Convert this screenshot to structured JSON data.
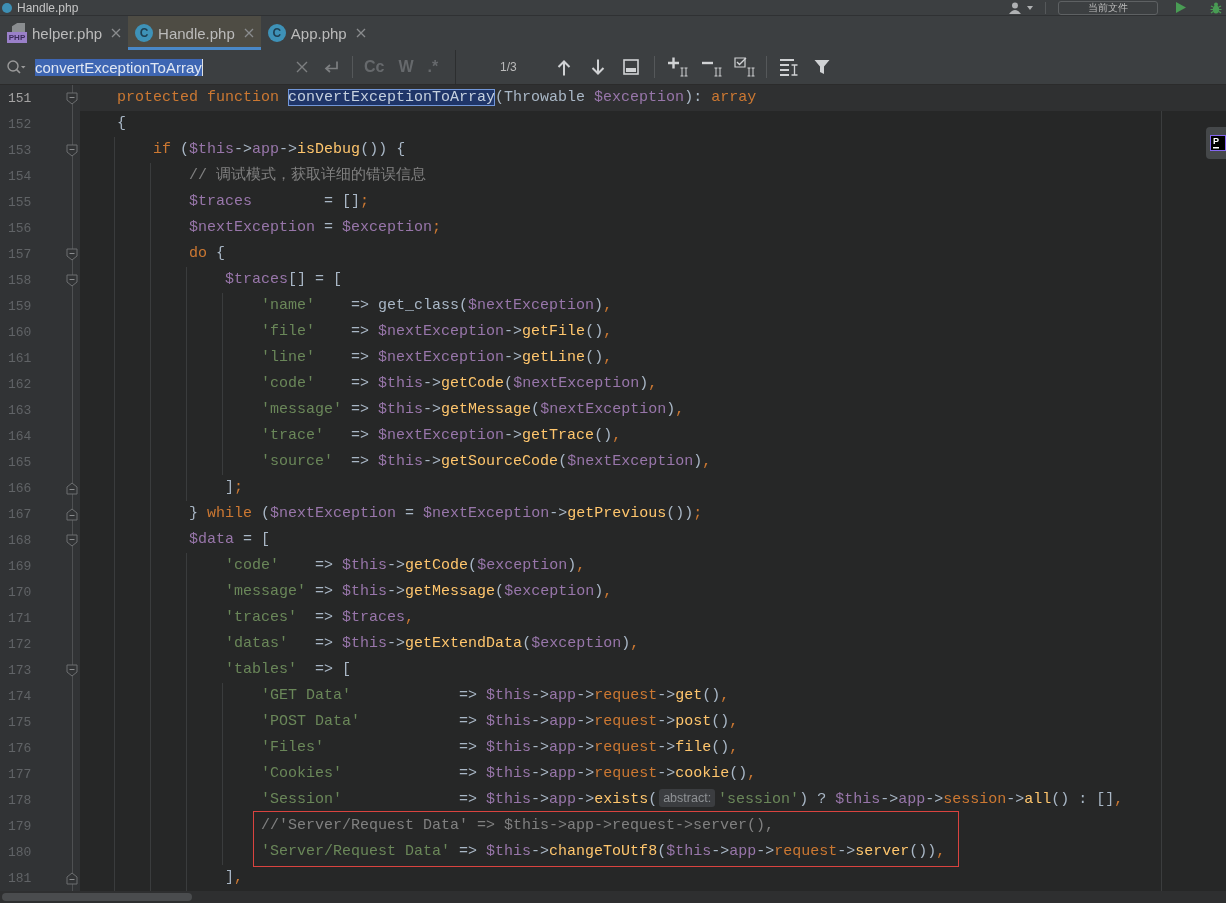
{
  "window": {
    "title": "Handle.php",
    "scope_button": "当前文件"
  },
  "tabs": [
    {
      "label": "helper.php",
      "kind": "php",
      "icon_text": "PHP",
      "selected": false
    },
    {
      "label": "Handle.php",
      "kind": "class",
      "icon_text": "C",
      "selected": true
    },
    {
      "label": "App.php",
      "kind": "class",
      "icon_text": "C",
      "selected": false
    }
  ],
  "search": {
    "query": "convertExceptionToArray",
    "query_selected": true,
    "toggles": [
      {
        "label": "Cc",
        "on": false
      },
      {
        "label": "W",
        "on": false
      },
      {
        "label": ".*",
        "on": false
      }
    ],
    "match_count": "1/3"
  },
  "editor": {
    "blocks": [
      {
        "kind": "plain",
        "lines": [
          {
            "number": "151",
            "kind": "fold_start",
            "current": true,
            "tokens": [
              {
                "kind": "keyword",
                "text": "protected function "
              },
              {
                "kind": "match",
                "text": "convertExceptionToArray"
              },
              {
                "kind": "plain",
                "text": "(Throwable "
              },
              {
                "kind": "variable",
                "text": "$exception"
              },
              {
                "kind": "plain",
                "text": "): "
              },
              {
                "kind": "keyword",
                "text": "array"
              }
            ]
          },
          {
            "number": "152",
            "kind": "plain",
            "current": false,
            "tokens": [
              {
                "kind": "plain",
                "text": "{"
              }
            ]
          },
          {
            "number": "153",
            "kind": "fold_start",
            "current": false,
            "tokens": [
              {
                "kind": "keyword",
                "text": "    if"
              },
              {
                "kind": "plain",
                "text": " ("
              },
              {
                "kind": "variable",
                "text": "$this"
              },
              {
                "kind": "plain",
                "text": "->"
              },
              {
                "kind": "field",
                "text": "app"
              },
              {
                "kind": "plain",
                "text": "->"
              },
              {
                "kind": "method",
                "text": "isDebug"
              },
              {
                "kind": "plain",
                "text": "()) {"
              }
            ]
          },
          {
            "number": "154",
            "kind": "plain",
            "current": false,
            "tokens": [
              {
                "kind": "comment",
                "text": "        // 调试模式，获取详细的错误信息"
              }
            ]
          },
          {
            "number": "155",
            "kind": "plain",
            "current": false,
            "tokens": [
              {
                "kind": "variable",
                "text": "        $traces"
              },
              {
                "kind": "plain",
                "text": "        = []"
              },
              {
                "kind": "punctuation",
                "text": ";"
              }
            ]
          },
          {
            "number": "156",
            "kind": "plain",
            "current": false,
            "tokens": [
              {
                "kind": "variable",
                "text": "        $nextException"
              },
              {
                "kind": "plain",
                "text": " = "
              },
              {
                "kind": "variable",
                "text": "$exception"
              },
              {
                "kind": "punctuation",
                "text": ";"
              }
            ]
          },
          {
            "number": "157",
            "kind": "fold_start",
            "current": false,
            "tokens": [
              {
                "kind": "keyword",
                "text": "        do"
              },
              {
                "kind": "plain",
                "text": " {"
              }
            ]
          },
          {
            "number": "158",
            "kind": "fold_start",
            "current": false,
            "tokens": [
              {
                "kind": "variable",
                "text": "            $traces"
              },
              {
                "kind": "plain",
                "text": "[] = ["
              }
            ]
          },
          {
            "number": "159",
            "kind": "plain",
            "current": false,
            "tokens": [
              {
                "kind": "string",
                "text": "                'name'"
              },
              {
                "kind": "plain",
                "text": "    => get_class("
              },
              {
                "kind": "variable",
                "text": "$nextException"
              },
              {
                "kind": "plain",
                "text": ")"
              },
              {
                "kind": "punctuation",
                "text": ","
              }
            ]
          },
          {
            "number": "160",
            "kind": "plain",
            "current": false,
            "tokens": [
              {
                "kind": "string",
                "text": "                'file'"
              },
              {
                "kind": "plain",
                "text": "    => "
              },
              {
                "kind": "variable",
                "text": "$nextException"
              },
              {
                "kind": "plain",
                "text": "->"
              },
              {
                "kind": "method",
                "text": "getFile"
              },
              {
                "kind": "plain",
                "text": "()"
              },
              {
                "kind": "punctuation",
                "text": ","
              }
            ]
          },
          {
            "number": "161",
            "kind": "plain",
            "current": false,
            "tokens": [
              {
                "kind": "string",
                "text": "                'line'"
              },
              {
                "kind": "plain",
                "text": "    => "
              },
              {
                "kind": "variable",
                "text": "$nextException"
              },
              {
                "kind": "plain",
                "text": "->"
              },
              {
                "kind": "method",
                "text": "getLine"
              },
              {
                "kind": "plain",
                "text": "()"
              },
              {
                "kind": "punctuation",
                "text": ","
              }
            ]
          },
          {
            "number": "162",
            "kind": "plain",
            "current": false,
            "tokens": [
              {
                "kind": "string",
                "text": "                'code'"
              },
              {
                "kind": "plain",
                "text": "    => "
              },
              {
                "kind": "variable",
                "text": "$this"
              },
              {
                "kind": "plain",
                "text": "->"
              },
              {
                "kind": "method",
                "text": "getCode"
              },
              {
                "kind": "plain",
                "text": "("
              },
              {
                "kind": "variable",
                "text": "$nextException"
              },
              {
                "kind": "plain",
                "text": ")"
              },
              {
                "kind": "punctuation",
                "text": ","
              }
            ]
          },
          {
            "number": "163",
            "kind": "plain",
            "current": false,
            "tokens": [
              {
                "kind": "string",
                "text": "                'message'"
              },
              {
                "kind": "plain",
                "text": " => "
              },
              {
                "kind": "variable",
                "text": "$this"
              },
              {
                "kind": "plain",
                "text": "->"
              },
              {
                "kind": "method",
                "text": "getMessage"
              },
              {
                "kind": "plain",
                "text": "("
              },
              {
                "kind": "variable",
                "text": "$nextException"
              },
              {
                "kind": "plain",
                "text": ")"
              },
              {
                "kind": "punctuation",
                "text": ","
              }
            ]
          },
          {
            "number": "164",
            "kind": "plain",
            "current": false,
            "tokens": [
              {
                "kind": "string",
                "text": "                'trace'"
              },
              {
                "kind": "plain",
                "text": "   => "
              },
              {
                "kind": "variable",
                "text": "$nextException"
              },
              {
                "kind": "plain",
                "text": "->"
              },
              {
                "kind": "method",
                "text": "getTrace"
              },
              {
                "kind": "plain",
                "text": "()"
              },
              {
                "kind": "punctuation",
                "text": ","
              }
            ]
          },
          {
            "number": "165",
            "kind": "plain",
            "current": false,
            "tokens": [
              {
                "kind": "string",
                "text": "                'source'"
              },
              {
                "kind": "plain",
                "text": "  => "
              },
              {
                "kind": "variable",
                "text": "$this"
              },
              {
                "kind": "plain",
                "text": "->"
              },
              {
                "kind": "method",
                "text": "getSourceCode"
              },
              {
                "kind": "plain",
                "text": "("
              },
              {
                "kind": "variable",
                "text": "$nextException"
              },
              {
                "kind": "plain",
                "text": ")"
              },
              {
                "kind": "punctuation",
                "text": ","
              }
            ]
          },
          {
            "number": "166",
            "kind": "fold_end",
            "current": false,
            "tokens": [
              {
                "kind": "plain",
                "text": "            ]"
              },
              {
                "kind": "punctuation",
                "text": ";"
              }
            ]
          },
          {
            "number": "167",
            "kind": "fold_end",
            "current": false,
            "tokens": [
              {
                "kind": "plain",
                "text": "        } "
              },
              {
                "kind": "keyword",
                "text": "while"
              },
              {
                "kind": "plain",
                "text": " ("
              },
              {
                "kind": "variable",
                "text": "$nextException"
              },
              {
                "kind": "plain",
                "text": " = "
              },
              {
                "kind": "variable",
                "text": "$nextException"
              },
              {
                "kind": "plain",
                "text": "->"
              },
              {
                "kind": "method",
                "text": "getPrevious"
              },
              {
                "kind": "plain",
                "text": "())"
              },
              {
                "kind": "punctuation",
                "text": ";"
              }
            ]
          },
          {
            "number": "168",
            "kind": "fold_start",
            "current": false,
            "tokens": [
              {
                "kind": "variable",
                "text": "        $data"
              },
              {
                "kind": "plain",
                "text": " = ["
              }
            ]
          },
          {
            "number": "169",
            "kind": "plain",
            "current": false,
            "tokens": [
              {
                "kind": "string",
                "text": "            'code'"
              },
              {
                "kind": "plain",
                "text": "    => "
              },
              {
                "kind": "variable",
                "text": "$this"
              },
              {
                "kind": "plain",
                "text": "->"
              },
              {
                "kind": "method",
                "text": "getCode"
              },
              {
                "kind": "plain",
                "text": "("
              },
              {
                "kind": "variable",
                "text": "$exception"
              },
              {
                "kind": "plain",
                "text": ")"
              },
              {
                "kind": "punctuation",
                "text": ","
              }
            ]
          },
          {
            "number": "170",
            "kind": "plain",
            "current": false,
            "tokens": [
              {
                "kind": "string",
                "text": "            'message'"
              },
              {
                "kind": "plain",
                "text": " => "
              },
              {
                "kind": "variable",
                "text": "$this"
              },
              {
                "kind": "plain",
                "text": "->"
              },
              {
                "kind": "method",
                "text": "getMessage"
              },
              {
                "kind": "plain",
                "text": "("
              },
              {
                "kind": "variable",
                "text": "$exception"
              },
              {
                "kind": "plain",
                "text": ")"
              },
              {
                "kind": "punctuation",
                "text": ","
              }
            ]
          },
          {
            "number": "171",
            "kind": "plain",
            "current": false,
            "tokens": [
              {
                "kind": "string",
                "text": "            'traces'"
              },
              {
                "kind": "plain",
                "text": "  => "
              },
              {
                "kind": "variable",
                "text": "$traces"
              },
              {
                "kind": "punctuation",
                "text": ","
              }
            ]
          },
          {
            "number": "172",
            "kind": "plain",
            "current": false,
            "tokens": [
              {
                "kind": "string",
                "text": "            'datas'"
              },
              {
                "kind": "plain",
                "text": "   => "
              },
              {
                "kind": "variable",
                "text": "$this"
              },
              {
                "kind": "plain",
                "text": "->"
              },
              {
                "kind": "method",
                "text": "getExtendData"
              },
              {
                "kind": "plain",
                "text": "("
              },
              {
                "kind": "variable",
                "text": "$exception"
              },
              {
                "kind": "plain",
                "text": ")"
              },
              {
                "kind": "punctuation",
                "text": ","
              }
            ]
          },
          {
            "number": "173",
            "kind": "fold_start",
            "current": false,
            "tokens": [
              {
                "kind": "string",
                "text": "            'tables'"
              },
              {
                "kind": "plain",
                "text": "  => ["
              }
            ]
          },
          {
            "number": "174",
            "kind": "plain",
            "current": false,
            "tokens": [
              {
                "kind": "string",
                "text": "                'GET Data'"
              },
              {
                "kind": "plain",
                "text": "            => "
              },
              {
                "kind": "variable",
                "text": "$this"
              },
              {
                "kind": "plain",
                "text": "->"
              },
              {
                "kind": "field",
                "text": "app"
              },
              {
                "kind": "plain",
                "text": "->"
              },
              {
                "kind": "magic_field",
                "text": "request"
              },
              {
                "kind": "plain",
                "text": "->"
              },
              {
                "kind": "method",
                "text": "get"
              },
              {
                "kind": "plain",
                "text": "()"
              },
              {
                "kind": "punctuation",
                "text": ","
              }
            ]
          },
          {
            "number": "175",
            "kind": "plain",
            "current": false,
            "tokens": [
              {
                "kind": "string",
                "text": "                'POST Data'"
              },
              {
                "kind": "plain",
                "text": "           => "
              },
              {
                "kind": "variable",
                "text": "$this"
              },
              {
                "kind": "plain",
                "text": "->"
              },
              {
                "kind": "field",
                "text": "app"
              },
              {
                "kind": "plain",
                "text": "->"
              },
              {
                "kind": "magic_field",
                "text": "request"
              },
              {
                "kind": "plain",
                "text": "->"
              },
              {
                "kind": "method",
                "text": "post"
              },
              {
                "kind": "plain",
                "text": "()"
              },
              {
                "kind": "punctuation",
                "text": ","
              }
            ]
          },
          {
            "number": "176",
            "kind": "plain",
            "current": false,
            "tokens": [
              {
                "kind": "string",
                "text": "                'Files'"
              },
              {
                "kind": "plain",
                "text": "               => "
              },
              {
                "kind": "variable",
                "text": "$this"
              },
              {
                "kind": "plain",
                "text": "->"
              },
              {
                "kind": "field",
                "text": "app"
              },
              {
                "kind": "plain",
                "text": "->"
              },
              {
                "kind": "magic_field",
                "text": "request"
              },
              {
                "kind": "plain",
                "text": "->"
              },
              {
                "kind": "method",
                "text": "file"
              },
              {
                "kind": "plain",
                "text": "()"
              },
              {
                "kind": "punctuation",
                "text": ","
              }
            ]
          },
          {
            "number": "177",
            "kind": "plain",
            "current": false,
            "tokens": [
              {
                "kind": "string",
                "text": "                'Cookies'"
              },
              {
                "kind": "plain",
                "text": "             => "
              },
              {
                "kind": "variable",
                "text": "$this"
              },
              {
                "kind": "plain",
                "text": "->"
              },
              {
                "kind": "field",
                "text": "app"
              },
              {
                "kind": "plain",
                "text": "->"
              },
              {
                "kind": "magic_field",
                "text": "request"
              },
              {
                "kind": "plain",
                "text": "->"
              },
              {
                "kind": "method",
                "text": "cookie"
              },
              {
                "kind": "plain",
                "text": "()"
              },
              {
                "kind": "punctuation",
                "text": ","
              }
            ]
          },
          {
            "number": "178",
            "kind": "plain",
            "current": false,
            "tokens": [
              {
                "kind": "string",
                "text": "                'Session'"
              },
              {
                "kind": "plain",
                "text": "             => "
              },
              {
                "kind": "variable",
                "text": "$this"
              },
              {
                "kind": "plain",
                "text": "->"
              },
              {
                "kind": "field",
                "text": "app"
              },
              {
                "kind": "plain",
                "text": "->"
              },
              {
                "kind": "method",
                "text": "exists"
              },
              {
                "kind": "plain",
                "text": "("
              },
              {
                "kind": "hint",
                "text": "abstract:"
              },
              {
                "kind": "string",
                "text": "'session'"
              },
              {
                "kind": "plain",
                "text": ") ? "
              },
              {
                "kind": "variable",
                "text": "$this"
              },
              {
                "kind": "plain",
                "text": "->"
              },
              {
                "kind": "field",
                "text": "app"
              },
              {
                "kind": "plain",
                "text": "->"
              },
              {
                "kind": "magic_field",
                "text": "session"
              },
              {
                "kind": "plain",
                "text": "->"
              },
              {
                "kind": "method",
                "text": "all"
              },
              {
                "kind": "plain",
                "text": "() : []"
              },
              {
                "kind": "punctuation",
                "text": ","
              }
            ]
          }
        ]
      },
      {
        "kind": "framed",
        "lines": [
          {
            "number": "179",
            "kind": "plain",
            "current": false,
            "tokens": [
              {
                "kind": "comment",
                "text": "                //'Server/Request Data' => $this->app->request->server(),"
              }
            ]
          },
          {
            "number": "180",
            "kind": "plain",
            "current": false,
            "tokens": [
              {
                "kind": "string",
                "text": "                'Server/Request Data'"
              },
              {
                "kind": "plain",
                "text": " => "
              },
              {
                "kind": "variable",
                "text": "$this"
              },
              {
                "kind": "plain",
                "text": "->"
              },
              {
                "kind": "method",
                "text": "changeToUtf8"
              },
              {
                "kind": "plain",
                "text": "("
              },
              {
                "kind": "variable",
                "text": "$this"
              },
              {
                "kind": "plain",
                "text": "->"
              },
              {
                "kind": "field",
                "text": "app"
              },
              {
                "kind": "plain",
                "text": "->"
              },
              {
                "kind": "magic_field",
                "text": "request"
              },
              {
                "kind": "plain",
                "text": "->"
              },
              {
                "kind": "method",
                "text": "server"
              },
              {
                "kind": "plain",
                "text": "())"
              },
              {
                "kind": "punctuation",
                "text": ","
              }
            ]
          }
        ]
      },
      {
        "kind": "plain",
        "lines": [
          {
            "number": "181",
            "kind": "fold_end",
            "current": false,
            "tokens": [
              {
                "kind": "plain",
                "text": "            ]"
              },
              {
                "kind": "punctuation",
                "text": ","
              }
            ]
          }
        ]
      }
    ]
  },
  "popup": {
    "logo_text": "P"
  }
}
